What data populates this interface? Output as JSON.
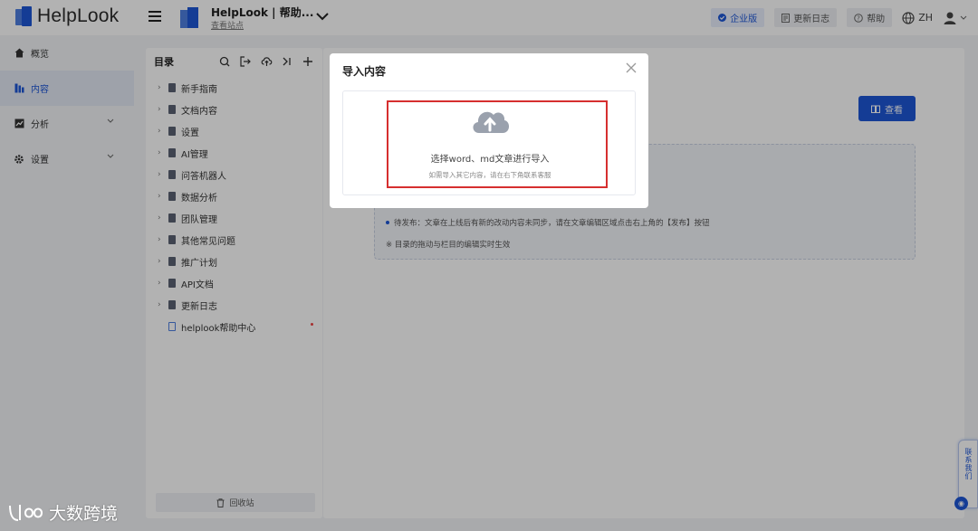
{
  "brand": {
    "name": "HelpLook"
  },
  "site": {
    "name": "HelpLook | 帮助...",
    "link": "查看站点"
  },
  "header": {
    "enterprise_label": "企业版",
    "changelog_label": "更新日志",
    "help_label": "帮助",
    "lang_label": "ZH"
  },
  "sidebar": {
    "items": [
      {
        "label": "概览",
        "icon": "home-icon"
      },
      {
        "label": "内容",
        "icon": "content-icon",
        "active": true
      },
      {
        "label": "分析",
        "icon": "chart-icon",
        "expandable": true
      },
      {
        "label": "设置",
        "icon": "gear-icon",
        "expandable": true
      }
    ]
  },
  "tree": {
    "title": "目录",
    "items": [
      {
        "label": "新手指南"
      },
      {
        "label": "文档内容"
      },
      {
        "label": "设置"
      },
      {
        "label": "AI管理"
      },
      {
        "label": "问答机器人"
      },
      {
        "label": "数据分析"
      },
      {
        "label": "团队管理"
      },
      {
        "label": "其他常见问题"
      },
      {
        "label": "推广计划"
      },
      {
        "label": "API文档"
      },
      {
        "label": "更新日志"
      },
      {
        "label": "helplook帮助中心"
      }
    ],
    "recycle_label": "回收站"
  },
  "main": {
    "view_label": "查看",
    "tip_lines": [
      "待发布：文章在上线后有新的改动内容未同步，请在文章编辑区域点击右上角的【发布】按钮",
      "※ 目录的拖动与栏目的编辑实时生效"
    ]
  },
  "modal": {
    "title": "导入内容",
    "upload_text": "选择word、md文章进行导入",
    "upload_hint": "如需导入其它内容，请在右下角联系客服"
  },
  "float_button": {
    "label": "联系我们"
  },
  "watermark": {
    "text": "大数跨境"
  },
  "colors": {
    "accent": "#1d56d6",
    "highlight": "#d62f2f"
  }
}
